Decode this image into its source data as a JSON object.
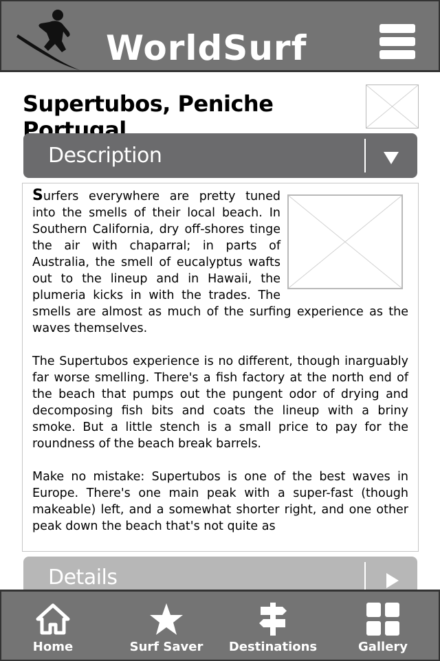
{
  "app": {
    "brand": "WorldSurf"
  },
  "page": {
    "title": "Supertubos, Peniche Portugal"
  },
  "sections": {
    "description": {
      "label": "Description",
      "expanded": true
    },
    "details": {
      "label": "Details",
      "expanded": false
    }
  },
  "description": {
    "dropcap": "S",
    "paragraph1_rest": "urfers everywhere are pretty tuned into the smells of their local beach. In Southern California, dry off-shores tinge the air with chaparral; in parts of Australia, the smell of eucalyptus wafts out to the lineup and in Hawaii, the plumeria kicks in with the trades. The smells are almost as much of the surfing experience as the waves themselves.",
    "paragraph2": "The Supertubos experience is no different, though inarguably far worse smelling. There's a fish factory at the north end of the beach that pumps out the pungent odor of drying and decomposing fish bits and coats the lineup with a briny smoke. But a little stench is a small price to pay for the roundness of the beach break barrels.",
    "paragraph3": "Make no mistake: Supertubos is one of the best waves in Europe. There's one main peak with a super-fast (though makeable) left, and a somewhat shorter right, and one other peak down the beach that's not quite as"
  },
  "nav": [
    {
      "label": "Home",
      "icon": "home-icon"
    },
    {
      "label": "Surf Saver",
      "icon": "star-icon"
    },
    {
      "label": "Destinations",
      "icon": "signpost-icon"
    },
    {
      "label": "Gallery",
      "icon": "grid-icon"
    }
  ],
  "colors": {
    "header_bg": "#747474",
    "accordion_active": "#6b6b6d",
    "accordion_inactive": "#b7b7b7"
  }
}
